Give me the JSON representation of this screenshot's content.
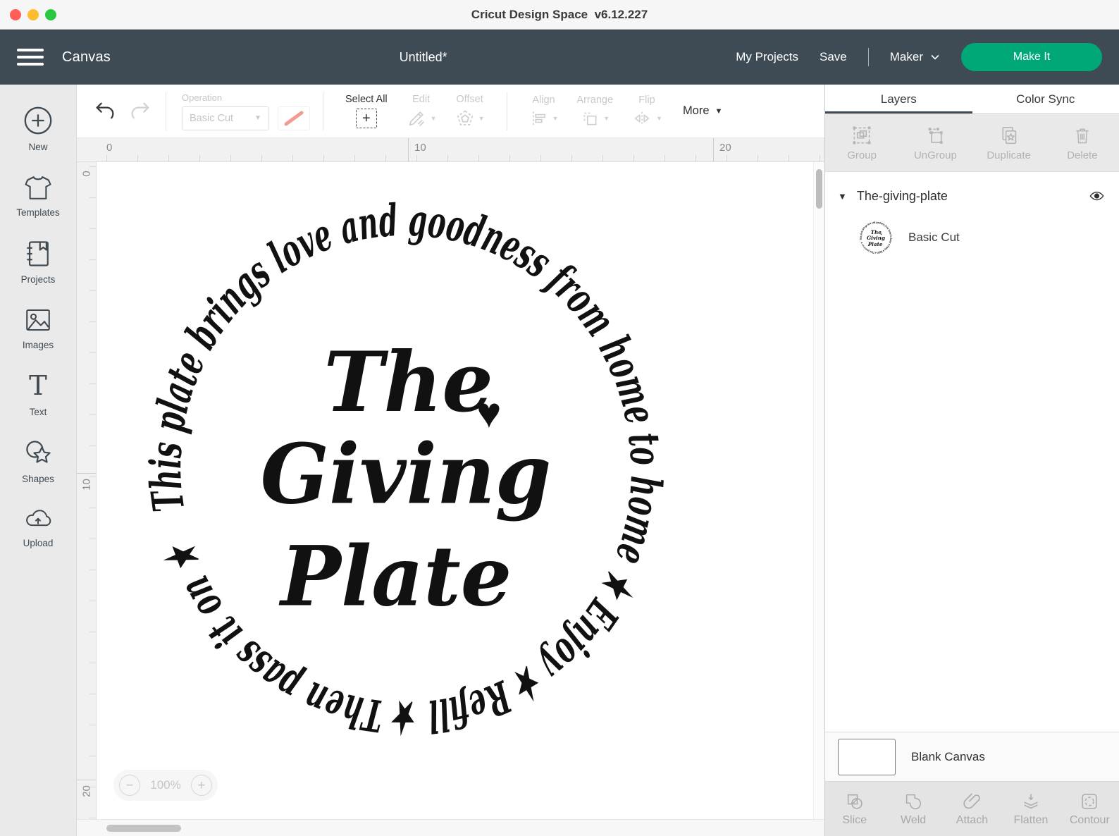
{
  "window": {
    "title": "Cricut Design Space  v6.12.227"
  },
  "header": {
    "canvas_label": "Canvas",
    "doc_title": "Untitled*",
    "my_projects": "My Projects",
    "save": "Save",
    "machine": "Maker",
    "make_it": "Make It"
  },
  "sidebar": {
    "items": [
      {
        "label": "New"
      },
      {
        "label": "Templates"
      },
      {
        "label": "Projects"
      },
      {
        "label": "Images"
      },
      {
        "label": "Text"
      },
      {
        "label": "Shapes"
      },
      {
        "label": "Upload"
      }
    ]
  },
  "toolbar": {
    "operation_label": "Operation",
    "operation_value": "Basic Cut",
    "select_all": "Select All",
    "edit": "Edit",
    "offset": "Offset",
    "align": "Align",
    "arrange": "Arrange",
    "flip": "Flip",
    "more": "More"
  },
  "ruler": {
    "h": [
      "0",
      "10",
      "20"
    ],
    "v": [
      "0",
      "10",
      "20"
    ]
  },
  "zoom": {
    "minus": "−",
    "value": "100%",
    "plus": "+"
  },
  "design": {
    "ring_text": "This plate brings love and goodness from home to home ★ Enjoy ★ Refill ★ Then pass it on ★",
    "line1": "The",
    "heart": "♥",
    "line2": "Giving",
    "line3": "Plate"
  },
  "layers_panel": {
    "tabs": [
      "Layers",
      "Color Sync"
    ],
    "actions": [
      "Group",
      "UnGroup",
      "Duplicate",
      "Delete"
    ],
    "group_name": "The-giving-plate",
    "layer_name": "Basic Cut",
    "blank_canvas": "Blank Canvas",
    "bottom_actions": [
      "Slice",
      "Weld",
      "Attach",
      "Flatten",
      "Contour"
    ]
  },
  "colors": {
    "header_bg": "#3e4b55",
    "accent_green": "#00a878",
    "cut_line": "#f29b94"
  }
}
